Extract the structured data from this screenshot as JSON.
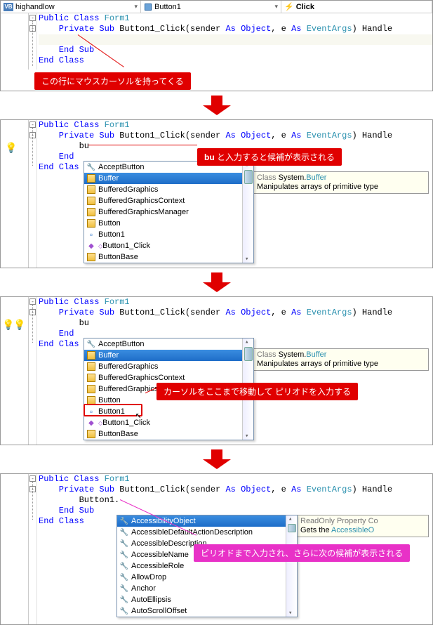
{
  "toolbar": {
    "project": "highandlow",
    "object": "Button1",
    "event": "Click"
  },
  "code": {
    "line1_pre": "Public Class ",
    "line1_cls": "Form1",
    "line2_pre": "    Private Sub ",
    "line2_name": "Button1_Click(sender ",
    "line2_as": "As ",
    "line2_obj": "Object",
    "line2_comma": ", e ",
    "line2_as2": "As ",
    "line2_evt": "EventArgs",
    "line2_tail": ") Handle",
    "line3_blank": "",
    "line4": "    End Sub",
    "line5": "End Class",
    "typed_bu": "        bu",
    "typed_button1": "        Button1.",
    "end_inline": "    End ",
    "end_cls_inline": "End Clas"
  },
  "callouts": {
    "c1": "この行にマウスカーソルを持ってくる",
    "c2_bold": "bu",
    "c2_rest": " と入力すると候補が表示される",
    "c3": "カーソルをここまで移動して ピリオドを入力する",
    "c4": "ピリオドまで入力され、さらに次の候補が表示される"
  },
  "intellisense1": {
    "items": [
      "AcceptButton",
      "Buffer",
      "BufferedGraphics",
      "BufferedGraphicsContext",
      "BufferedGraphicsManager",
      "Button",
      "Button1",
      "Button1_Click",
      "ButtonBase"
    ],
    "selected": "Buffer",
    "tooltip_line1_pre": "Class ",
    "tooltip_line1_ns": "System.",
    "tooltip_line1_cls": "Buffer",
    "tooltip_line2": "Manipulates arrays of primitive type"
  },
  "intellisense2": {
    "items": [
      "AccessibilityObject",
      "AccessibleDefaultActionDescription",
      "AccessibleDescription",
      "AccessibleName",
      "AccessibleRole",
      "AllowDrop",
      "Anchor",
      "AutoEllipsis",
      "AutoScrollOffset"
    ],
    "selected": "AccessibilityObject",
    "tooltip_line1": "ReadOnly Property Co",
    "tooltip_line2_pre": "Gets the ",
    "tooltip_line2_cls": "AccessibleO"
  }
}
